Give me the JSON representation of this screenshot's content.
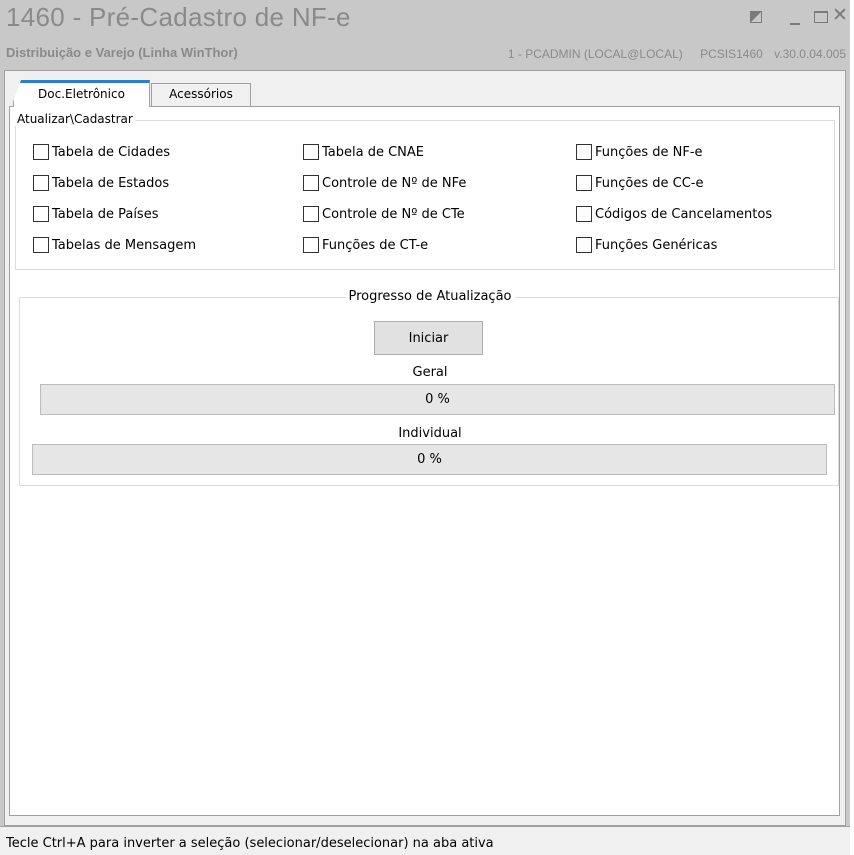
{
  "window": {
    "title": "1460 - Pré-Cadastro de NF-e",
    "subtitle": "Distribuição e Varejo (Linha WinThor)",
    "user": "1 - PCADMIN (LOCAL@LOCAL)",
    "program": "PCSIS1460",
    "version": "v.30.0.04.005"
  },
  "tabs": [
    {
      "label": "Doc.Eletrônico",
      "active": true
    },
    {
      "label": "Acessórios",
      "active": false
    }
  ],
  "atualizar": {
    "legend": "Atualizar\\Cadastrar",
    "columns": [
      [
        {
          "label": "Tabela de Cidades",
          "checked": false
        },
        {
          "label": "Tabela de Estados",
          "checked": false
        },
        {
          "label": "Tabela de Países",
          "checked": false
        },
        {
          "label": "Tabelas de Mensagem",
          "checked": false
        }
      ],
      [
        {
          "label": "Tabela de CNAE",
          "checked": false
        },
        {
          "label": "Controle de Nº de NFe",
          "checked": false
        },
        {
          "label": "Controle de Nº de CTe",
          "checked": false
        },
        {
          "label": "Funções de CT-e",
          "checked": false
        }
      ],
      [
        {
          "label": "Funções de NF-e",
          "checked": false
        },
        {
          "label": "Funções de CC-e",
          "checked": false
        },
        {
          "label": "Códigos de Cancelamentos",
          "checked": false
        },
        {
          "label": "Funções Genéricas",
          "checked": false
        }
      ]
    ]
  },
  "progress": {
    "legend": "Progresso de Atualização",
    "start_button": "Iniciar",
    "geral_label": "Geral",
    "geral_text": "0 %",
    "geral_value": 0,
    "individual_label": "Individual",
    "individual_text": "0 %",
    "individual_value": 0
  },
  "status_bar": {
    "text": "Tecle Ctrl+A para inverter a seleção (selecionar/deselecionar) na aba ativa"
  }
}
